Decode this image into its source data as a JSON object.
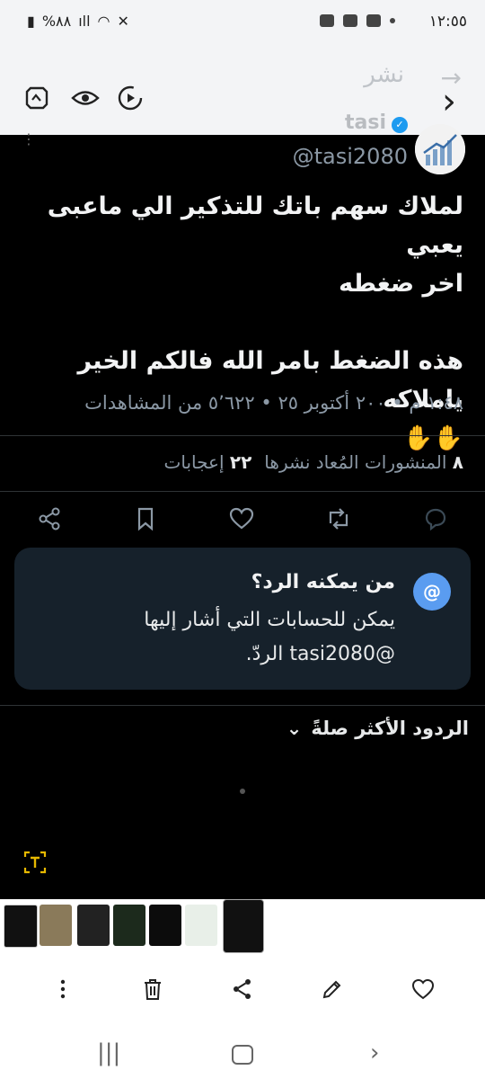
{
  "status": {
    "time": "١٢:٥٥",
    "battery": "%٨٨"
  },
  "toolbar": {
    "title": "نشر",
    "back_arrow": "→",
    "chevron": "›"
  },
  "tweet": {
    "name": "tasi",
    "handle": "@tasi2080",
    "text": "لملاك سهم باتك للتذكير الي ماعبى يعبي\nاخر ضغطه\n\nهذه الضغط بامر الله فالكم الخير ياملاكه\n✋✋",
    "meta": "١:٤٨ م • ٢٠٠ أكتوبر ٢٥ • ٥٬٦٢٢ من المشاهدات",
    "reposts_count": "٨",
    "reposts_label": "المنشورات المُعاد نشرها",
    "likes_count": "٢٢",
    "likes_label": "إعجابات"
  },
  "reply_card": {
    "at_symbol": "@",
    "title": "من يمكنه الرد؟",
    "body": "يمكن للحسابات التي أشار إليها @tasi2080 الردّ."
  },
  "replies_sort": {
    "label": "الردود الأكثر صلةً",
    "chevron": "⌄"
  },
  "colors": {
    "accent": "#1d9bf0",
    "card_bg": "#16212b",
    "background": "#000000"
  },
  "icons": [
    "share-icon",
    "bookmark-icon",
    "like-icon",
    "repost-icon",
    "reply-icon",
    "trash-icon",
    "edit-icon",
    "heart-icon",
    "more-icon"
  ]
}
